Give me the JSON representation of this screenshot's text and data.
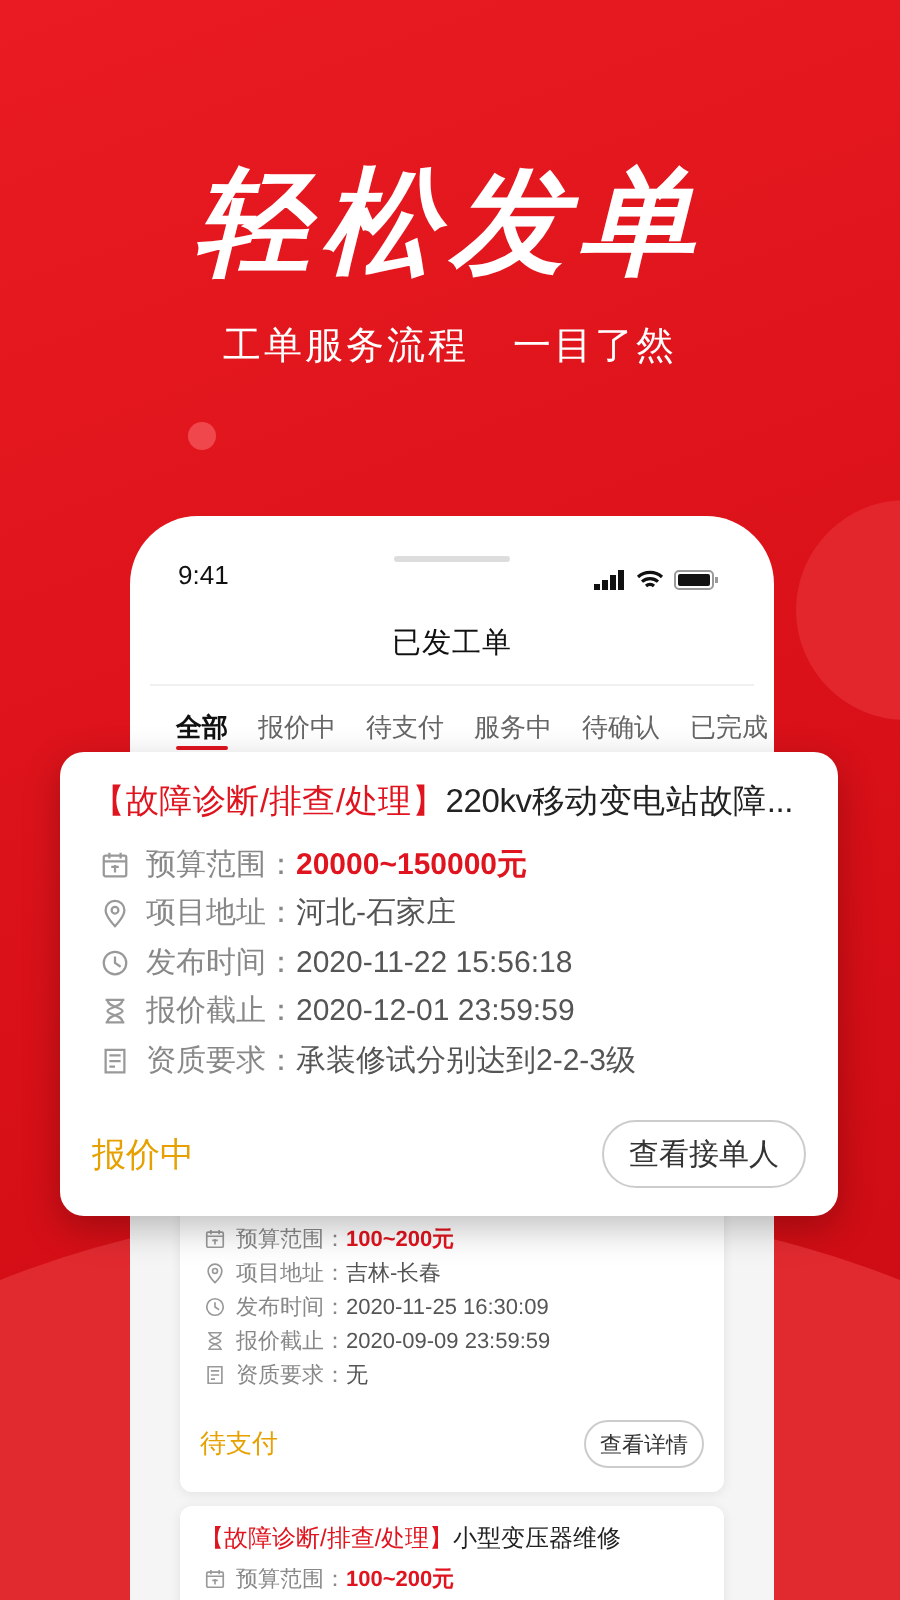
{
  "headline": "轻松发单",
  "tagline": [
    "工单服务流程",
    "一目了然"
  ],
  "phone": {
    "status_bar": {
      "time": "9:41"
    },
    "title": "已发工单",
    "tabs": [
      {
        "label": "全部",
        "selected": true
      },
      {
        "label": "报价中",
        "selected": false
      },
      {
        "label": "待支付",
        "selected": false
      },
      {
        "label": "服务中",
        "selected": false
      },
      {
        "label": "待确认",
        "selected": false
      },
      {
        "label": "已完成",
        "selected": false
      }
    ],
    "orders": [
      {
        "elevated": true,
        "category": "【故障诊断/排查/处理】",
        "title": "220kv移动变电站故障...",
        "fields": [
          {
            "kind": "budget",
            "label": "预算范围：",
            "value": "20000~150000元"
          },
          {
            "kind": "address",
            "label": "项目地址：",
            "value": "河北-石家庄"
          },
          {
            "kind": "time",
            "label": "发布时间：",
            "value": "2020-11-22 15:56:18"
          },
          {
            "kind": "deadline",
            "label": "报价截止：",
            "value": "2020-12-01 23:59:59"
          },
          {
            "kind": "qualification",
            "label": "资质要求：",
            "value": "承装修试分别达到2-2-3级"
          }
        ],
        "status": "报价中",
        "action": "查看接单人"
      },
      {
        "elevated": false,
        "fields": [
          {
            "kind": "budget",
            "label": "预算范围：",
            "value": "100~200元"
          },
          {
            "kind": "address",
            "label": "项目地址：",
            "value": "吉林-长春"
          },
          {
            "kind": "time",
            "label": "发布时间：",
            "value": "2020-11-25 16:30:09"
          },
          {
            "kind": "deadline",
            "label": "报价截止：",
            "value": "2020-09-09 23:59:59"
          },
          {
            "kind": "qualification",
            "label": "资质要求：",
            "value": "无"
          }
        ],
        "status": "待支付",
        "action": "查看详情"
      },
      {
        "elevated": false,
        "category": "【故障诊断/排查/处理】",
        "title": "小型变压器维修",
        "fields": [
          {
            "kind": "budget",
            "label": "预算范围：",
            "value": "100~200元"
          }
        ]
      }
    ]
  }
}
